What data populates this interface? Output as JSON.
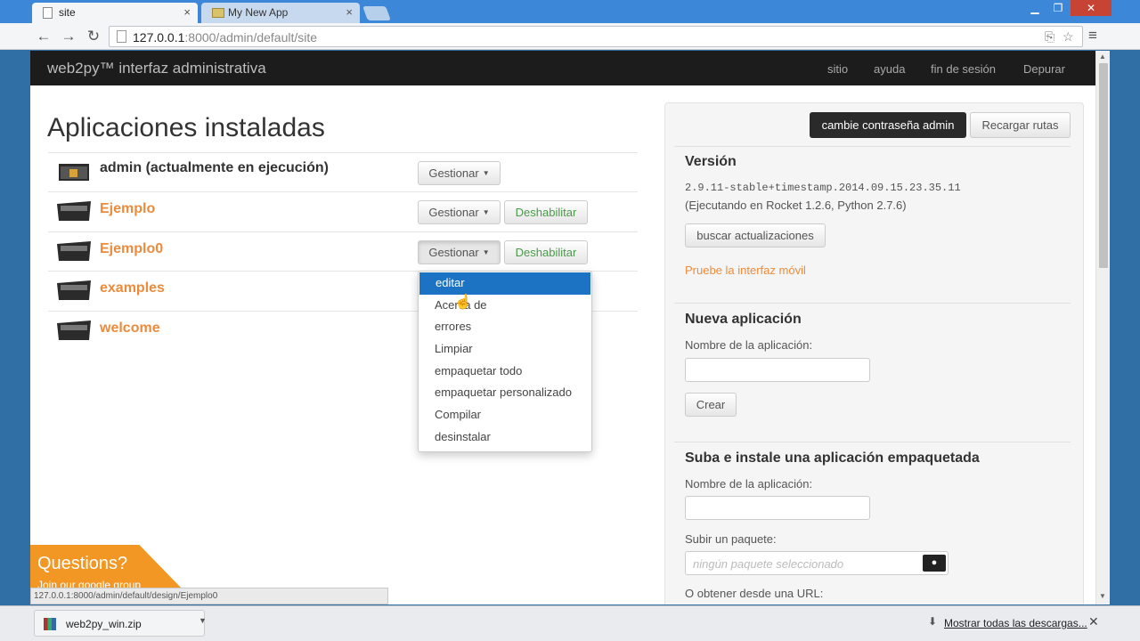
{
  "browser": {
    "tabs": [
      {
        "label": "site",
        "active": true
      },
      {
        "label": "My New App",
        "active": false
      }
    ],
    "url_host": "127.0.0.1",
    "url_rest": ":8000/admin/default/site",
    "status_url": "127.0.0.1:8000/admin/default/design/Ejemplo0"
  },
  "navbar": {
    "brand": "web2py™ interfaz administrativa",
    "links": [
      "sitio",
      "ayuda",
      "fin de sesión",
      "Depurar"
    ]
  },
  "main": {
    "title": "Aplicaciones instaladas",
    "apps": [
      {
        "name": "admin (actualmente en ejecución)",
        "current": true
      },
      {
        "name": "Ejemplo",
        "current": false
      },
      {
        "name": "Ejemplo0",
        "current": false
      },
      {
        "name": "examples",
        "current": false
      },
      {
        "name": "welcome",
        "current": false
      }
    ],
    "manage_label": "Gestionar",
    "disable_label": "Deshabilitar",
    "dropdown_items": [
      "editar",
      "Acerca de",
      "errores",
      "Limpiar",
      "empaquetar todo",
      "empaquetar personalizado",
      "Compilar",
      "desinstalar"
    ],
    "dropdown_active": "editar"
  },
  "sidebar": {
    "change_password": "cambie contraseña admin",
    "reload_routes": "Recargar rutas",
    "version_title": "Versión",
    "version_value": "2.9.11-stable+timestamp.2014.09.15.23.35.11",
    "running_on": "(Ejecutando en Rocket 1.2.6, Python 2.7.6)",
    "check_updates": "buscar actualizaciones",
    "mobile_link": "Pruebe la interfaz móvil",
    "new_app_title": "Nueva aplicación",
    "app_name_label": "Nombre de la aplicación:",
    "create_label": "Crear",
    "upload_title": "Suba e instale una aplicación empaquetada",
    "upload_app_name_label": "Nombre de la aplicación:",
    "upload_package_label": "Subir un paquete:",
    "file_placeholder": "ningún paquete seleccionado",
    "url_label": "O obtener desde una URL:"
  },
  "questions": {
    "title": "Questions?",
    "subtitle": "Join our google group"
  },
  "downloads": {
    "file_name": "web2py_win.zip",
    "show_all": "Mostrar todas las descargas..."
  },
  "colors": {
    "accent": "#ec8b3c",
    "navbar": "#1c1c1c",
    "dropdown_active": "#1c73c4",
    "disable_text": "#4a9a4a"
  }
}
